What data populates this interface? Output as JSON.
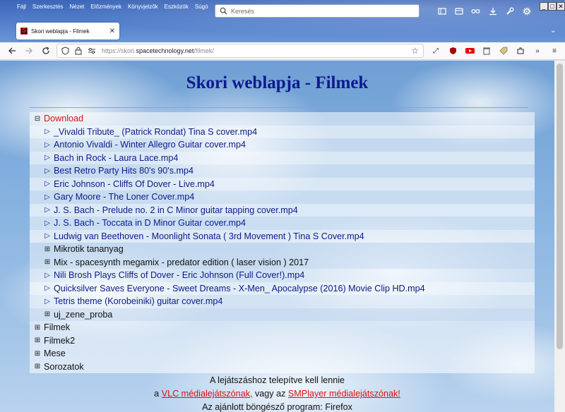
{
  "menu": [
    "Fájl",
    "Szerkesztés",
    "Nézet",
    "Előzmények",
    "Könyvjelzők",
    "Eszközök",
    "Súgó"
  ],
  "search": {
    "placeholder": "Keresés"
  },
  "tab": {
    "title": "Skori weblapja - Filmek",
    "close": "✕"
  },
  "address": {
    "prefix": "https://skori.",
    "domain": "spacetechnology.net",
    "path": "/filmek/"
  },
  "page": {
    "title": "Skori weblapja - Filmek",
    "tree": [
      {
        "level": 0,
        "type": "open-folder",
        "marker": "⊟",
        "label": "Download"
      },
      {
        "level": 1,
        "type": "file",
        "marker": "▷",
        "label": "_Vivaldi Tribute_ (Patrick Rondat) Tina S cover.mp4"
      },
      {
        "level": 1,
        "type": "file",
        "marker": "▷",
        "label": "Antonio Vivaldi - Winter Allegro Guitar cover.mp4"
      },
      {
        "level": 1,
        "type": "file",
        "marker": "▷",
        "label": "Bach in Rock - Laura Lace.mp4"
      },
      {
        "level": 1,
        "type": "file",
        "marker": "▷",
        "label": "Best Retro Party Hits 80's 90's.mp4"
      },
      {
        "level": 1,
        "type": "file",
        "marker": "▷",
        "label": "Eric Johnson - Cliffs Of Dover - Live.mp4"
      },
      {
        "level": 1,
        "type": "file",
        "marker": "▷",
        "label": "Gary Moore - The Loner Cover.mp4"
      },
      {
        "level": 1,
        "type": "file",
        "marker": "▷",
        "label": "J. S. Bach - Prelude no. 2 in C Minor guitar tapping cover.mp4"
      },
      {
        "level": 1,
        "type": "file",
        "marker": "▷",
        "label": "J. S. Bach - Toccata in D Minor Guitar cover.mp4"
      },
      {
        "level": 1,
        "type": "file",
        "marker": "▷",
        "label": "Ludwig van Beethoven - Moonlight Sonata ( 3rd Movement ) Tina S Cover.mp4"
      },
      {
        "level": 1,
        "type": "folder",
        "marker": "⊞",
        "label": "Mikrotik tananyag"
      },
      {
        "level": 1,
        "type": "folder",
        "marker": "⊞",
        "label": "Mix - spacesynth megamix - predator edition ( laser vision ) 2017"
      },
      {
        "level": 1,
        "type": "file",
        "marker": "▷",
        "label": "Nili Brosh Plays Cliffs of Dover - Eric Johnson (Full Cover!).mp4"
      },
      {
        "level": 1,
        "type": "file",
        "marker": "▷",
        "label": "Quicksilver Saves Everyone - Sweet Dreams - X-Men_ Apocalypse (2016) Movie Clip HD.mp4"
      },
      {
        "level": 1,
        "type": "file",
        "marker": "▷",
        "label": "Tetris theme (Korobeiniki) guitar cover.mp4"
      },
      {
        "level": 1,
        "type": "folder",
        "marker": "⊞",
        "label": "uj_zene_proba"
      },
      {
        "level": 0,
        "type": "folder",
        "marker": "⊞",
        "label": "Filmek"
      },
      {
        "level": 0,
        "type": "folder",
        "marker": "⊞",
        "label": "Filmek2"
      },
      {
        "level": 0,
        "type": "folder",
        "marker": "⊞",
        "label": "Mese"
      },
      {
        "level": 0,
        "type": "folder",
        "marker": "⊞",
        "label": "Sorozatok"
      }
    ],
    "footer": {
      "line1": "A lejátszáshoz telepítve kell lennie",
      "line2_pre": "a ",
      "vlc_link": "VLC médialejátszónak,",
      "line2_mid": " vagy az ",
      "smplayer_link": "SMPlayer médialejátszónak!",
      "line3": "Az ajánlott böngésző program: Firefox"
    }
  },
  "colors": {
    "title": "#0d1a8c",
    "open_folder": "#dd1111",
    "file_link": "#0b1a8a",
    "footer_link": "#dd1111"
  }
}
